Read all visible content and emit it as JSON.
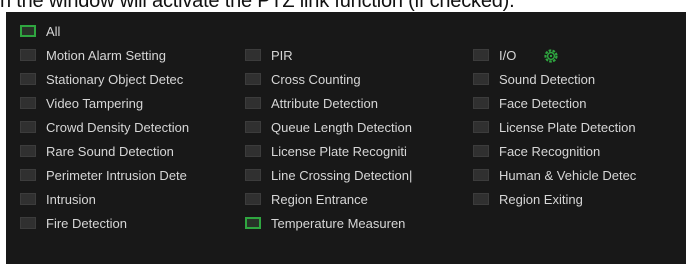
{
  "header": {
    "text": "n the window will activate the PTZ link function (if checked)."
  },
  "colors": {
    "panel_bg": "#181818",
    "checkbox_bg": "#303030",
    "checked_accent": "#2fa640",
    "label_text": "#d6d6d6"
  },
  "all_option": {
    "label": "All",
    "checked": true
  },
  "alarm_options": [
    [
      {
        "label": "Motion Alarm Setting",
        "checked": false
      },
      {
        "label": "PIR",
        "checked": false
      },
      {
        "label": "I/O",
        "checked": false,
        "icon": "gear-icon"
      }
    ],
    [
      {
        "label": "Stationary Object Detec",
        "checked": false
      },
      {
        "label": "Cross Counting",
        "checked": false
      },
      {
        "label": "Sound Detection",
        "checked": false
      }
    ],
    [
      {
        "label": "Video Tampering",
        "checked": false
      },
      {
        "label": "Attribute Detection",
        "checked": false
      },
      {
        "label": "Face Detection",
        "checked": false
      }
    ],
    [
      {
        "label": "Crowd Density Detection",
        "checked": false
      },
      {
        "label": "Queue Length Detection",
        "checked": false
      },
      {
        "label": "License Plate Detection",
        "checked": false
      }
    ],
    [
      {
        "label": "Rare Sound Detection",
        "checked": false
      },
      {
        "label": "License Plate Recogniti",
        "checked": false
      },
      {
        "label": "Face Recognition",
        "checked": false
      }
    ],
    [
      {
        "label": "Perimeter Intrusion Dete",
        "checked": false
      },
      {
        "label": "Line Crossing Detection|",
        "checked": false
      },
      {
        "label": "Human & Vehicle Detec",
        "checked": false
      }
    ],
    [
      {
        "label": "Intrusion",
        "checked": false
      },
      {
        "label": "Region Entrance",
        "checked": false
      },
      {
        "label": "Region Exiting",
        "checked": false
      }
    ],
    [
      {
        "label": "Fire Detection",
        "checked": false
      },
      {
        "label": "Temperature Measuren",
        "checked": true
      },
      null
    ]
  ]
}
